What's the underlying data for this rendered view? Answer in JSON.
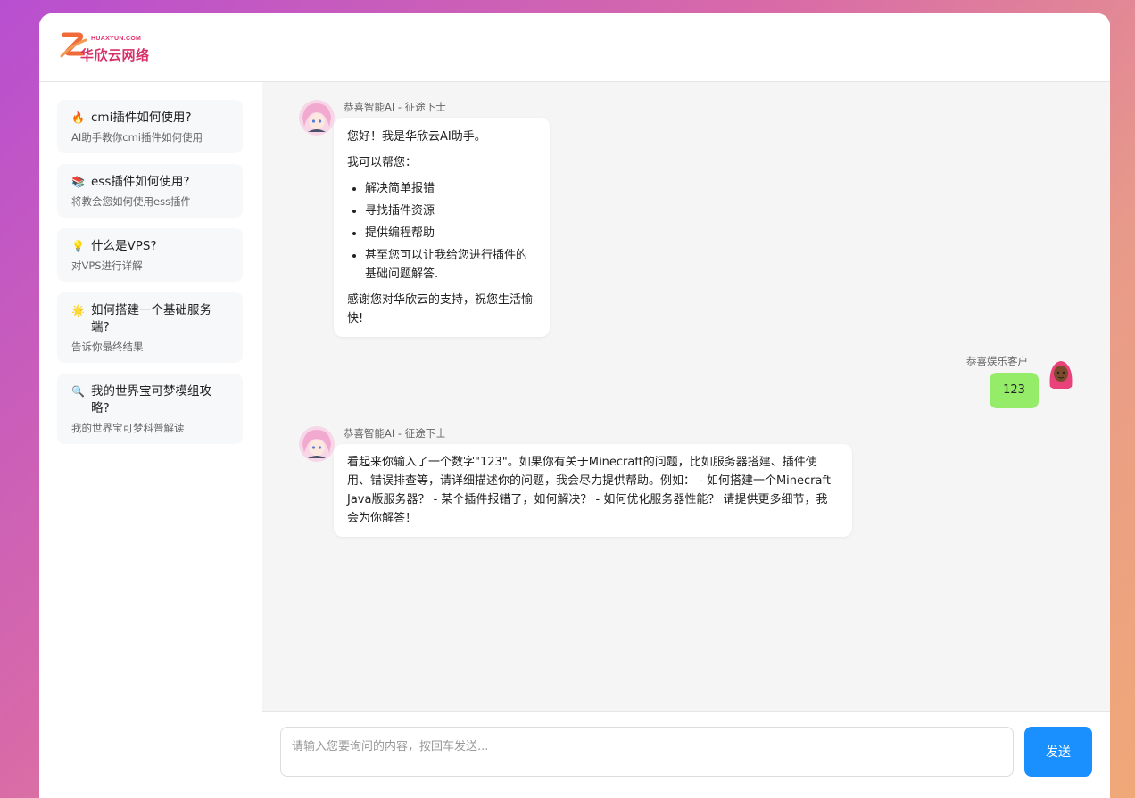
{
  "brand": {
    "name_en": "HUAXYUN.COM",
    "name_cn": "华欣云网络"
  },
  "sidebar": {
    "items": [
      {
        "emoji": "🔥",
        "title": "cmi插件如何使用?",
        "desc": "AI助手教你cmi插件如何使用"
      },
      {
        "emoji": "📚",
        "title": "ess插件如何使用?",
        "desc": "将教会您如何使用ess插件"
      },
      {
        "emoji": "💡",
        "title": "什么是VPS?",
        "desc": "对VPS进行详解"
      },
      {
        "emoji": "🌟",
        "title": "如何搭建一个基础服务端?",
        "desc": "告诉你最终结果"
      },
      {
        "emoji": "🔍",
        "title": "我的世界宝可梦模组攻略?",
        "desc": "我的世界宝可梦科普解读"
      }
    ]
  },
  "chat": {
    "messages": [
      {
        "sender": "恭喜智能AI - 征途下士",
        "greeting": "您好！我是华欣云AI助手。",
        "intro": "我可以帮您：",
        "list": [
          "解决简单报错",
          "寻找插件资源",
          "提供编程帮助",
          "甚至您可以让我给您进行插件的基础问题解答."
        ],
        "outro": "感谢您对华欣云的支持，祝您生活愉快!"
      },
      {
        "sender": "恭喜娱乐客户",
        "text": "123"
      },
      {
        "sender": "恭喜智能AI - 征途下士",
        "text": "看起来你输入了一个数字\"123\"。如果你有关于Minecraft的问题，比如服务器搭建、插件使用、错误排查等，请详细描述你的问题，我会尽力提供帮助。例如： - 如何搭建一个Minecraft Java版服务器？ - 某个插件报错了，如何解决？ - 如何优化服务器性能？ 请提供更多细节，我会为你解答！"
      }
    ]
  },
  "input": {
    "placeholder": "请输入您要询问的内容，按回车发送...",
    "send_label": "发送"
  },
  "colors": {
    "accent": "#1a90ff",
    "user_bubble": "#95ec69",
    "logo": "#e0306a"
  }
}
